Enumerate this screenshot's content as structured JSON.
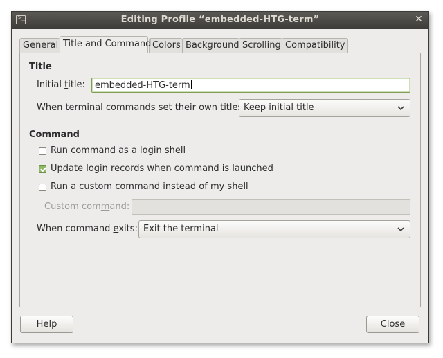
{
  "window": {
    "title": "Editing Profile “embedded-HTG-term”",
    "terminal_icon_glyph": ">_",
    "close_glyph": "✕"
  },
  "tabs": [
    {
      "label": "General",
      "active": false
    },
    {
      "label": "Title and Command",
      "active": true
    },
    {
      "label": "Colors",
      "active": false
    },
    {
      "label": "Background",
      "active": false
    },
    {
      "label": "Scrolling",
      "active": false
    },
    {
      "label": "Compatibility",
      "active": false
    }
  ],
  "title_section": {
    "heading": "Title",
    "initial_title_label_pre": "Initial ",
    "initial_title_label_mn": "t",
    "initial_title_label_post": "itle:",
    "initial_title_value": "embedded-HTG-term",
    "own_titles_label_pre": "When terminal commands set their o",
    "own_titles_label_mn": "w",
    "own_titles_label_post": "n titles:",
    "own_titles_value": "Keep initial title"
  },
  "command_section": {
    "heading": "Command",
    "login_shell": {
      "mn": "R",
      "rest": "un command as a login shell",
      "checked": false
    },
    "update_records": {
      "mn": "U",
      "rest": "pdate login records when command is launched",
      "checked": true
    },
    "custom_command": {
      "pre": "Ru",
      "mn": "n",
      "rest": " a custom command instead of my shell",
      "checked": false
    },
    "custom_command_label_pre": "Custom com",
    "custom_command_label_mn": "m",
    "custom_command_label_post": "and:",
    "custom_command_value": "",
    "exits_label_pre": "When command ",
    "exits_label_mn": "e",
    "exits_label_post": "xits:",
    "exits_value": "Exit the terminal"
  },
  "buttons": {
    "help": {
      "mn": "H",
      "rest": "elp"
    },
    "close": {
      "mn": "C",
      "rest": "lose"
    }
  }
}
